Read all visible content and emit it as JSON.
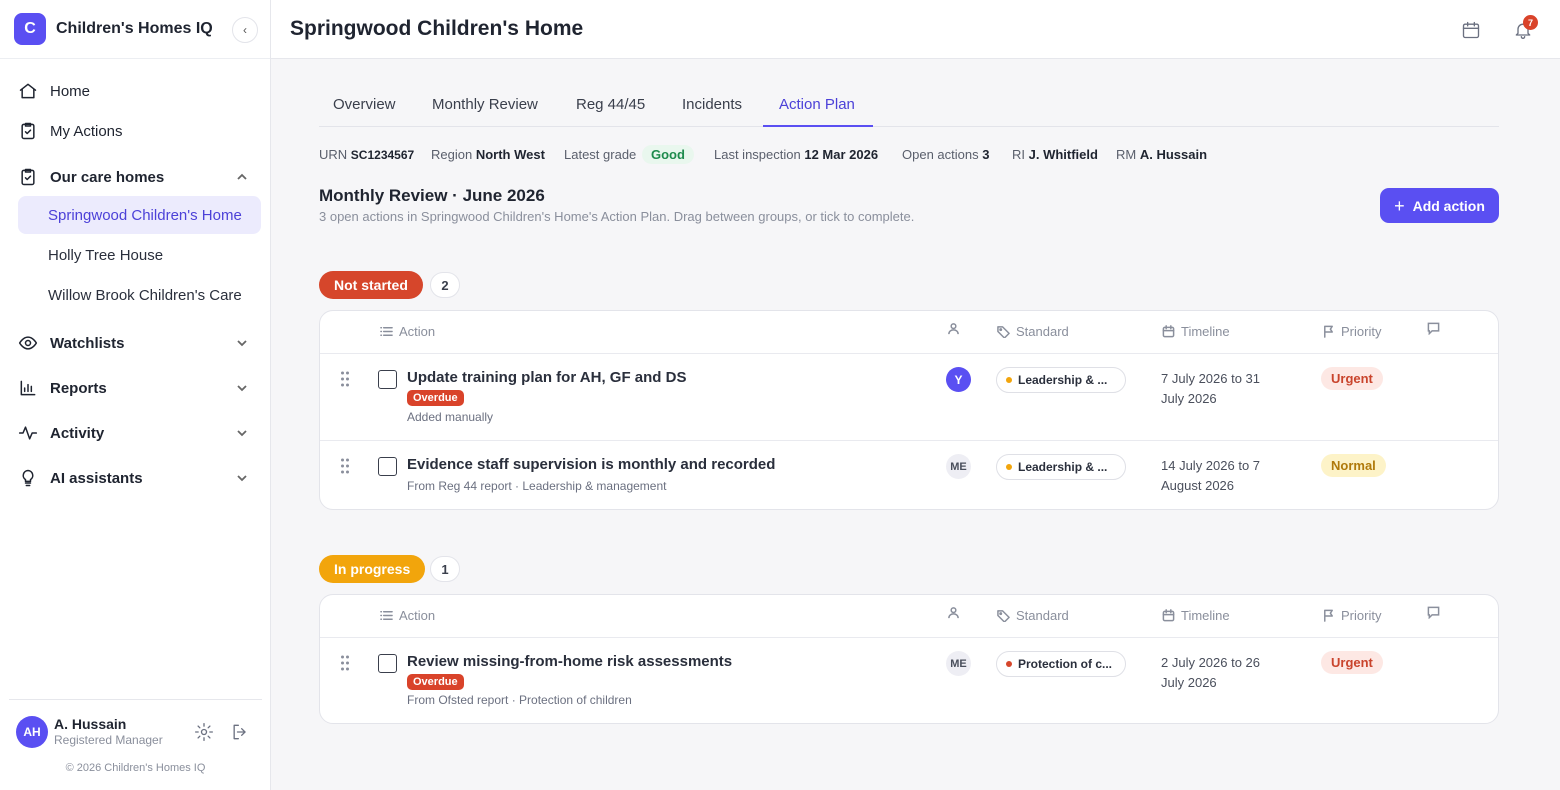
{
  "app": {
    "logo_letter": "C",
    "name": "Children's Homes IQ"
  },
  "nav": {
    "home": "Home",
    "my_actions": "My Actions",
    "our_care_homes": "Our care homes",
    "homes": [
      "Springwood Children's Home",
      "Holly Tree House",
      "Willow Brook Children's Care"
    ],
    "watchlists": "Watchlists",
    "reports": "Reports",
    "activity": "Activity",
    "ai_assistants": "AI assistants"
  },
  "user": {
    "initials": "AH",
    "name": "A. Hussain",
    "role": "Registered Manager"
  },
  "copyright": "© 2026 Children's Homes IQ",
  "header": {
    "title": "Springwood Children's Home",
    "notifications": "7"
  },
  "tabs": [
    "Overview",
    "Monthly Review",
    "Reg 44/45",
    "Incidents",
    "Action Plan"
  ],
  "meta": {
    "urn_label": "URN",
    "urn": "SC1234567",
    "region_label": "Region",
    "region": "North West",
    "grade_label": "Latest grade",
    "grade": "Good",
    "inspection_label": "Last inspection",
    "inspection": "12 Mar 2026",
    "open_label": "Open actions",
    "open": "3",
    "ri_label": "RI",
    "ri": "J. Whitfield",
    "rm_label": "RM",
    "rm": "A. Hussain"
  },
  "review": {
    "title": "Monthly Review · June 2026",
    "subtitle": "3 open actions in Springwood Children's Home's Action Plan. Drag between groups, or tick to complete.",
    "add_label": "Add action"
  },
  "columns": {
    "action": "Action",
    "standard": "Standard",
    "timeline": "Timeline",
    "priority": "Priority"
  },
  "groups": [
    {
      "label": "Not started",
      "count": "2",
      "color": "#d6462b",
      "rows": [
        {
          "title": "Update training plan for AH, GF and DS",
          "overdue": "Overdue",
          "source": "Added manually",
          "assignee": "Y",
          "standard": "Leadership & ...",
          "timeline": "7 July 2026 to 31 July 2026",
          "priority": "Urgent"
        },
        {
          "title": "Evidence staff supervision is monthly and recorded",
          "overdue": "",
          "source": "From Reg 44 report · Leadership & management",
          "assignee": "ME",
          "standard": "Leadership & ...",
          "timeline": "14 July 2026 to 7 August 2026",
          "priority": "Normal"
        }
      ]
    },
    {
      "label": "In progress",
      "count": "1",
      "color": "#f2a50c",
      "rows": [
        {
          "title": "Review missing-from-home risk assessments",
          "overdue": "Overdue",
          "source": "From Ofsted report · Protection of children",
          "assignee": "ME",
          "standard": "Protection of c...",
          "timeline": "2 July 2026 to 26 July 2026",
          "priority": "Urgent"
        }
      ]
    }
  ],
  "colors": {
    "accent": "#5a4ff2",
    "standard_leadership_dot": "#f2a50c",
    "standard_protection_dot": "#d6462b"
  }
}
